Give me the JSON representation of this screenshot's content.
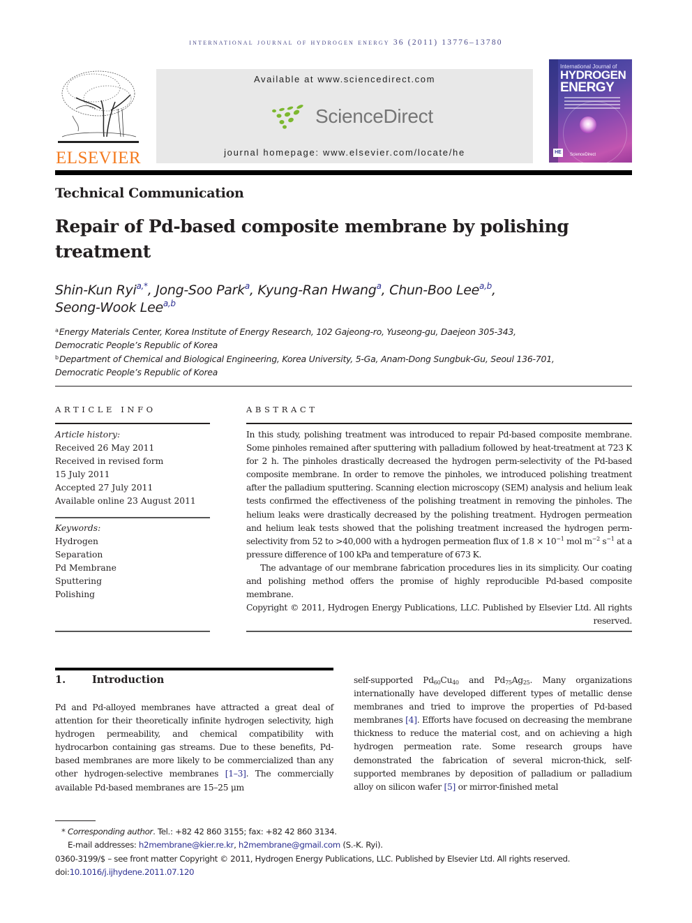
{
  "running_head": "International Journal of Hydrogen Energy 36 (2011) 13776–13780",
  "masthead": {
    "publisher_logo_text": "ELSEVIER",
    "available_at": "Available at www.sciencedirect.com",
    "sciencedirect_logo_text": "ScienceDirect",
    "journal_homepage": "journal homepage: www.elsevier.com/locate/he",
    "cover": {
      "line1": "International Journal of",
      "line2": "HYDROGEN",
      "line3": "ENERGY",
      "badge": "HE",
      "footer": "ScienceDirect"
    }
  },
  "article_type": "Technical Communication",
  "title": "Repair of Pd-based composite membrane by polishing treatment",
  "authors": [
    {
      "name": "Shin-Kun Ryi",
      "aff": "a,*",
      "sep": ", "
    },
    {
      "name": "Jong-Soo Park",
      "aff": "a",
      "sep": ", "
    },
    {
      "name": "Kyung-Ran Hwang",
      "aff": "a",
      "sep": ", "
    },
    {
      "name": "Chun-Boo Lee",
      "aff": "a,b",
      "sep": ","
    },
    {
      "name": "Seong-Wook Lee",
      "aff": "a,b",
      "sep": ""
    }
  ],
  "affiliations": [
    {
      "key": "a",
      "line1": "Energy Materials Center, Korea Institute of Energy Research, 102 Gajeong-ro, Yuseong-gu, Daejeon 305-343,",
      "line2": "Democratic People’s Republic of Korea"
    },
    {
      "key": "b",
      "line1": "Department of Chemical and Biological Engineering, Korea University, 5-Ga, Anam-Dong Sungbuk-Gu, Seoul 136-701,",
      "line2": "Democratic People’s Republic of Korea"
    }
  ],
  "article_info": {
    "label": "ARTICLE INFO",
    "history_label": "Article history:",
    "history": [
      "Received 26 May 2011",
      "Received in revised form",
      "15 July 2011",
      "Accepted 27 July 2011",
      "Available online 23 August 2011"
    ],
    "keywords_label": "Keywords:",
    "keywords": [
      "Hydrogen",
      "Separation",
      "Pd Membrane",
      "Sputtering",
      "Polishing"
    ]
  },
  "abstract": {
    "label": "ABSTRACT",
    "p1_a": "In this study, polishing treatment was introduced to repair Pd-based composite membrane. Some pinholes remained after sputtering with palladium followed by heat-treatment at 723 K for 2 h. The pinholes drastically decreased the hydrogen perm-selectivity of the Pd-based composite membrane. In order to remove the pinholes, we introduced polishing treatment after the palladium sputtering. Scanning election microscopy (SEM) analysis and helium leak tests confirmed the effectiveness of the polishing treatment in removing the pinholes. The helium leaks were drastically decreased by the polishing treatment. Hydrogen permeation and helium leak tests showed that the polishing treatment increased the hydrogen perm-selectivity from 52 to >40,000 with a hydrogen permeation flux of 1.8 × 10",
    "p1_exp1": "−1",
    "p1_b": " mol m",
    "p1_exp2": "−2",
    "p1_c": " s",
    "p1_exp3": "−1",
    "p1_d": " at a pressure difference of 100 kPa and temperature of 673 K.",
    "p2": "The advantage of our membrane fabrication procedures lies in its simplicity. Our coating and polishing method offers the promise of highly reproducible Pd-based composite membrane.",
    "copyright": "Copyright © 2011, Hydrogen Energy Publications, LLC. Published by Elsevier Ltd. All rights reserved."
  },
  "introduction": {
    "number": "1.",
    "heading": "Introduction",
    "left_a": "Pd and Pd-alloyed membranes have attracted a great deal of attention for their theoretically infinite hydrogen selectivity, high hydrogen permeability, and chemical compatibility with hydrocarbon containing gas streams. Due to these benefits, Pd-based membranes are more likely to be commercialized than any other hydrogen-selective membranes ",
    "left_ref": "[1–3]",
    "left_b": ". The commercially available Pd-based membranes are 15–25 μm",
    "right_a": "self-supported Pd",
    "right_sub1": "60",
    "right_b": "Cu",
    "right_sub2": "40",
    "right_c": " and Pd",
    "right_sub3": "75",
    "right_d": "Ag",
    "right_sub4": "25",
    "right_e": ". Many organizations internationally have developed different types of metallic dense membranes and tried to improve the properties of Pd-based membranes ",
    "right_ref1": "[4]",
    "right_f": ". Efforts have focused on decreasing the membrane thickness to reduce the material cost, and on achieving a high hydrogen permeation rate. Some research groups have demonstrated the fabrication of several micron-thick, self-supported membranes by deposition of palladium or palladium alloy on silicon wafer ",
    "right_ref2": "[5]",
    "right_g": " or mirror-finished metal"
  },
  "footnotes": {
    "star": "* ",
    "corr_label": "Corresponding author",
    "corr_text": ". Tel.: +82 42 860 3155; fax: +82 42 860 3134.",
    "email_label": "E-mail addresses: ",
    "email1": "h2membrane@kier.re.kr",
    "email_sep": ", ",
    "email2": "h2membrane@gmail.com",
    "email_suffix": " (S.-K. Ryi).",
    "issn_line": "0360-3199/$ – see front matter Copyright © 2011, Hydrogen Energy Publications, LLC. Published by Elsevier Ltd. All rights reserved.",
    "doi_label": "doi:",
    "doi": "10.1016/j.ijhydene.2011.07.120"
  },
  "colors": {
    "link": "#2e3192",
    "elsevier_orange": "#f47b20",
    "sciencedirect_green": "#7cb82f",
    "masthead_gray": "#e8e8e8"
  }
}
